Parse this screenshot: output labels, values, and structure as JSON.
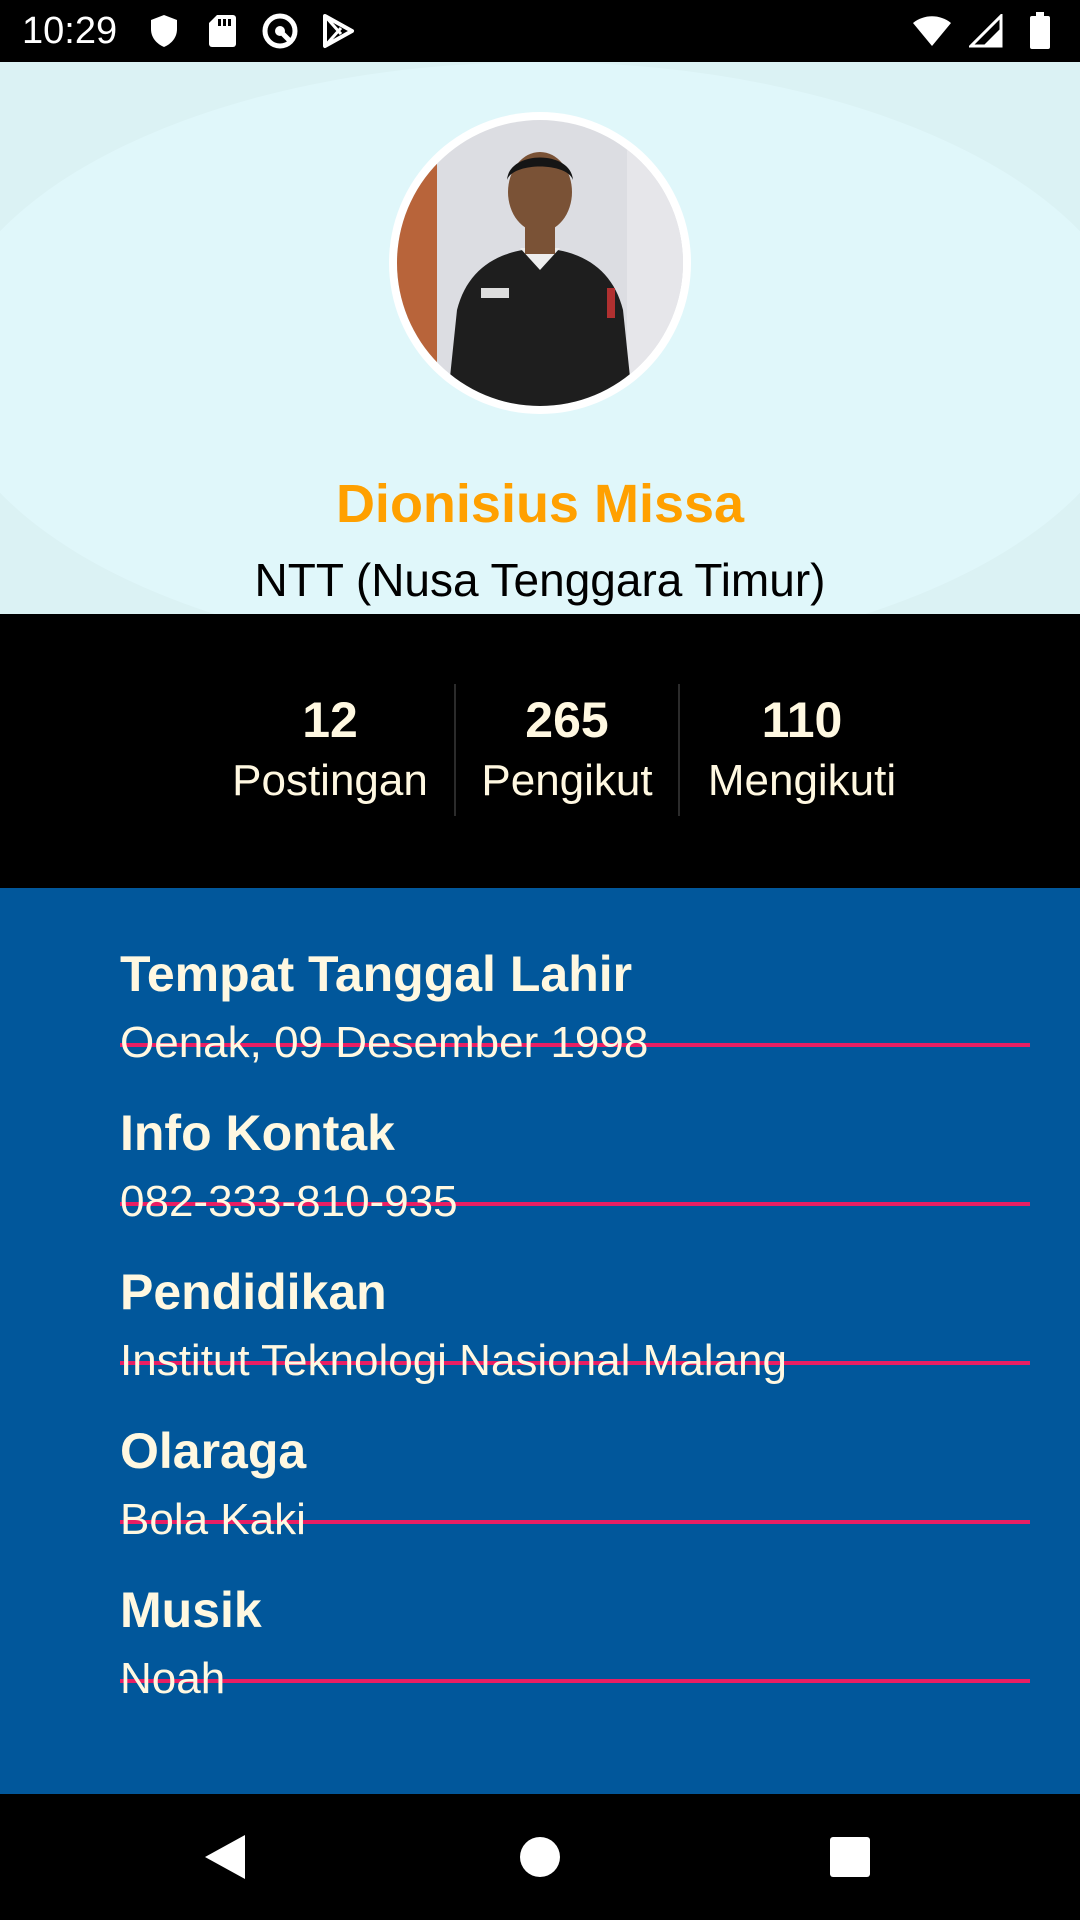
{
  "status_bar": {
    "time": "10:29",
    "left_icons": [
      "shield-icon",
      "sd-card-icon",
      "vpn-key-icon",
      "play-store-icon"
    ],
    "right_icons": [
      "wifi-icon",
      "signal-icon",
      "battery-icon"
    ]
  },
  "profile": {
    "name": "Dionisius Missa",
    "region": "NTT (Nusa Tenggara Timur)"
  },
  "stats": [
    {
      "value": "12",
      "label": "Postingan"
    },
    {
      "value": "265",
      "label": "Pengikut"
    },
    {
      "value": "110",
      "label": "Mengikuti"
    }
  ],
  "info": [
    {
      "title": "Tempat Tanggal Lahir",
      "value": "Oenak, 09 Desember 1998"
    },
    {
      "title": "Info Kontak",
      "value": "082-333-810-935"
    },
    {
      "title": "Pendidikan",
      "value": "Institut Teknologi Nasional Malang"
    },
    {
      "title": "Olaraga",
      "value": "Bola Kaki"
    },
    {
      "title": "Musik",
      "value": "Noah"
    }
  ],
  "nav_bar": {
    "buttons": [
      "back-icon",
      "home-icon",
      "recents-icon"
    ]
  },
  "colors": {
    "name": "#ffa000",
    "header_bg": "#e0f7fa",
    "info_bg": "#01579b",
    "divider": "#e91e63",
    "text_light": "#fff8e1"
  }
}
